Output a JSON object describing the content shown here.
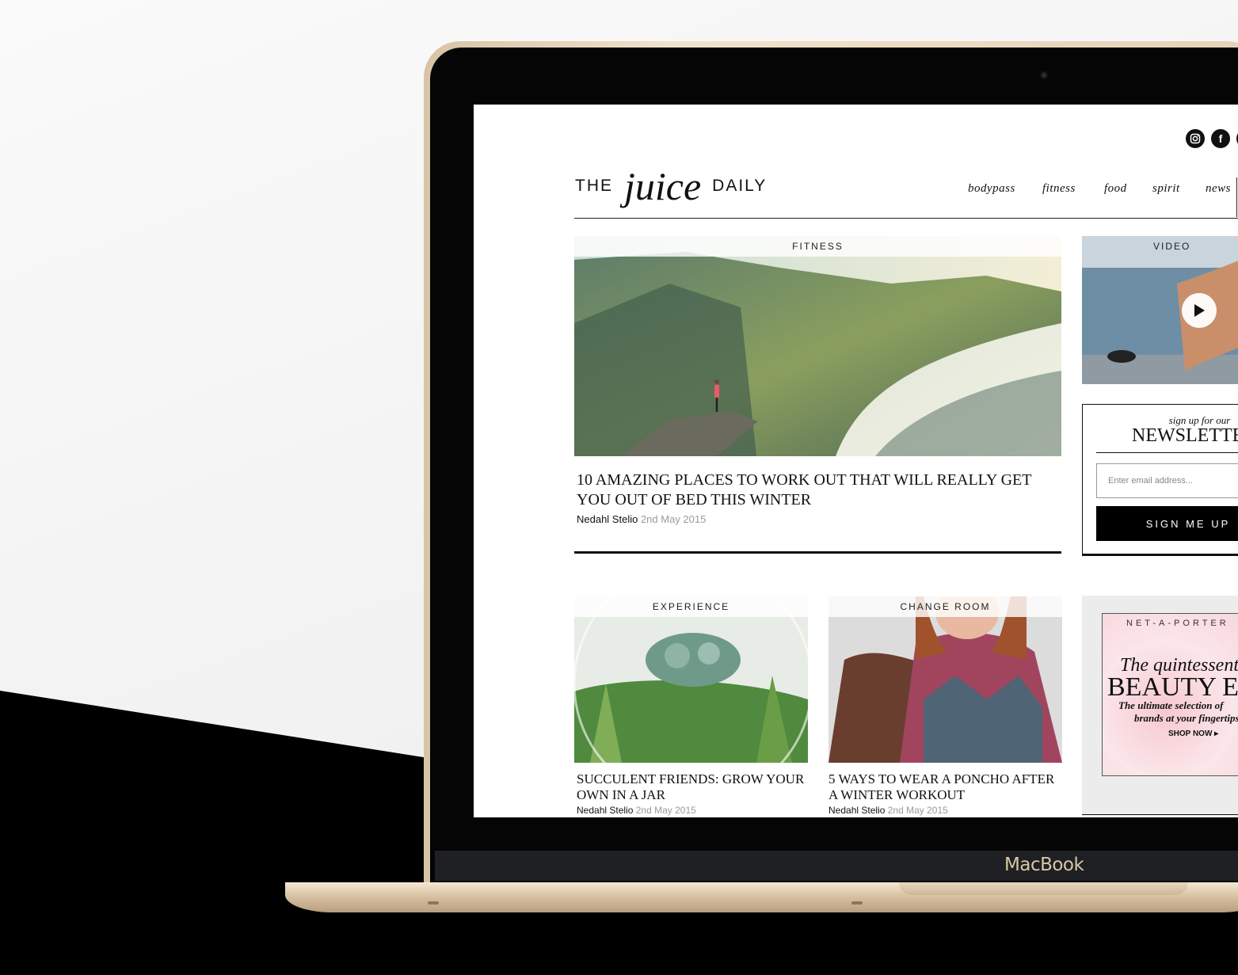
{
  "device": {
    "brand": "MacBook"
  },
  "site": {
    "logo": {
      "the": "THE",
      "juice": "juice",
      "daily": "DAILY"
    },
    "social": [
      "instagram-icon",
      "facebook-icon"
    ],
    "nav": [
      "bodypass",
      "fitness",
      "food",
      "spirit",
      "news"
    ]
  },
  "feature": {
    "category": "FITNESS",
    "headline": "10 AMAZING PLACES TO WORK OUT THAT WILL REALLY GET YOU OUT OF BED THIS WINTER",
    "author": "Nedahl Stelio",
    "date": "2nd May 2015"
  },
  "video": {
    "category": "VIDEO"
  },
  "newsletter": {
    "kicker": "sign up for our",
    "title": "NEWSLETTER",
    "email_placeholder": "Enter email address...",
    "button": "SIGN ME UP"
  },
  "articles": [
    {
      "category": "EXPERIENCE",
      "headline": "SUCCULENT FRIENDS: GROW YOUR OWN IN A JAR",
      "author": "Nedahl Stelio",
      "date": "2nd May 2015"
    },
    {
      "category": "CHANGE ROOM",
      "headline": "5 WAYS TO WEAR A PONCHO AFTER A WINTER WORKOUT",
      "author": "Nedahl Stelio",
      "date": "2nd May 2015"
    }
  ],
  "ad": {
    "brand": "NET-A-PORTER",
    "line1": "The quintessential",
    "line2": "BEAUTY EDIT",
    "line3": "The ultimate selection of",
    "line4": "brands at your fingertips",
    "cta": "SHOP NOW ▸"
  }
}
